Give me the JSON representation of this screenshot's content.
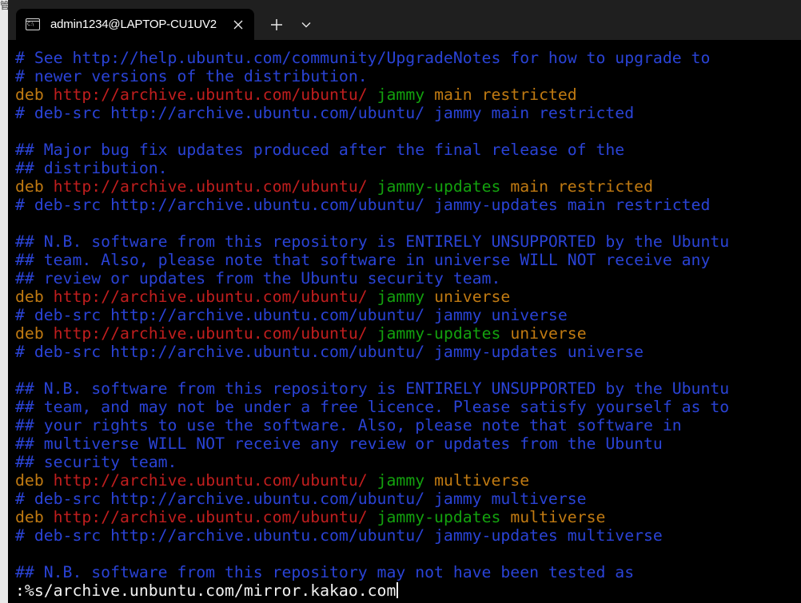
{
  "window": {
    "tab_title": "admin1234@LAPTOP-CU1UV2"
  },
  "background_window": {
    "edge_text": "管"
  },
  "colors": {
    "comment": "#2a43d6",
    "keyword": "#c07a12",
    "url": "#c01e1e",
    "suite": "#13a10e",
    "component": "#c07a12",
    "command": "#f2f2f2",
    "terminal_bg": "#000000",
    "titlebar_bg": "#1f1f1f"
  },
  "icons": {
    "tab_icon": "terminal-icon",
    "close": "close-icon",
    "new_tab": "plus-icon",
    "dropdown": "chevron-down-icon"
  },
  "terminal": {
    "lines": [
      [
        {
          "t": "# See http://help.ubuntu.com/community/UpgradeNotes for how to upgrade to",
          "c": "comment"
        }
      ],
      [
        {
          "t": "# newer versions of the distribution.",
          "c": "comment"
        }
      ],
      [
        {
          "t": "deb",
          "c": "keyword"
        },
        {
          "t": " ",
          "c": "plain"
        },
        {
          "t": "http://archive.ubuntu.com/ubuntu/",
          "c": "url"
        },
        {
          "t": " ",
          "c": "plain"
        },
        {
          "t": "jammy",
          "c": "suite"
        },
        {
          "t": " ",
          "c": "plain"
        },
        {
          "t": "main restricted",
          "c": "comp"
        }
      ],
      [
        {
          "t": "# deb-src http://archive.ubuntu.com/ubuntu/ jammy main restricted",
          "c": "comment"
        }
      ],
      [],
      [
        {
          "t": "## Major bug fix updates produced after the final release of the",
          "c": "comment"
        }
      ],
      [
        {
          "t": "## distribution.",
          "c": "comment"
        }
      ],
      [
        {
          "t": "deb",
          "c": "keyword"
        },
        {
          "t": " ",
          "c": "plain"
        },
        {
          "t": "http://archive.ubuntu.com/ubuntu/",
          "c": "url"
        },
        {
          "t": " ",
          "c": "plain"
        },
        {
          "t": "jammy-updates",
          "c": "suite"
        },
        {
          "t": " ",
          "c": "plain"
        },
        {
          "t": "main restricted",
          "c": "comp"
        }
      ],
      [
        {
          "t": "# deb-src http://archive.ubuntu.com/ubuntu/ jammy-updates main restricted",
          "c": "comment"
        }
      ],
      [],
      [
        {
          "t": "## N.B. software from this repository is ENTIRELY UNSUPPORTED by the Ubuntu",
          "c": "comment"
        }
      ],
      [
        {
          "t": "## team. Also, please note that software in universe WILL NOT receive any",
          "c": "comment"
        }
      ],
      [
        {
          "t": "## review or updates from the Ubuntu security team.",
          "c": "comment"
        }
      ],
      [
        {
          "t": "deb",
          "c": "keyword"
        },
        {
          "t": " ",
          "c": "plain"
        },
        {
          "t": "http://archive.ubuntu.com/ubuntu/",
          "c": "url"
        },
        {
          "t": " ",
          "c": "plain"
        },
        {
          "t": "jammy",
          "c": "suite"
        },
        {
          "t": " ",
          "c": "plain"
        },
        {
          "t": "universe",
          "c": "comp"
        }
      ],
      [
        {
          "t": "# deb-src http://archive.ubuntu.com/ubuntu/ jammy universe",
          "c": "comment"
        }
      ],
      [
        {
          "t": "deb",
          "c": "keyword"
        },
        {
          "t": " ",
          "c": "plain"
        },
        {
          "t": "http://archive.ubuntu.com/ubuntu/",
          "c": "url"
        },
        {
          "t": " ",
          "c": "plain"
        },
        {
          "t": "jammy-updates",
          "c": "suite"
        },
        {
          "t": " ",
          "c": "plain"
        },
        {
          "t": "universe",
          "c": "comp"
        }
      ],
      [
        {
          "t": "# deb-src http://archive.ubuntu.com/ubuntu/ jammy-updates universe",
          "c": "comment"
        }
      ],
      [],
      [
        {
          "t": "## N.B. software from this repository is ENTIRELY UNSUPPORTED by the Ubuntu",
          "c": "comment"
        }
      ],
      [
        {
          "t": "## team, and may not be under a free licence. Please satisfy yourself as to",
          "c": "comment"
        }
      ],
      [
        {
          "t": "## your rights to use the software. Also, please note that software in",
          "c": "comment"
        }
      ],
      [
        {
          "t": "## multiverse WILL NOT receive any review or updates from the Ubuntu",
          "c": "comment"
        }
      ],
      [
        {
          "t": "## security team.",
          "c": "comment"
        }
      ],
      [
        {
          "t": "deb",
          "c": "keyword"
        },
        {
          "t": " ",
          "c": "plain"
        },
        {
          "t": "http://archive.ubuntu.com/ubuntu/",
          "c": "url"
        },
        {
          "t": " ",
          "c": "plain"
        },
        {
          "t": "jammy",
          "c": "suite"
        },
        {
          "t": " ",
          "c": "plain"
        },
        {
          "t": "multiverse",
          "c": "comp"
        }
      ],
      [
        {
          "t": "# deb-src http://archive.ubuntu.com/ubuntu/ jammy multiverse",
          "c": "comment"
        }
      ],
      [
        {
          "t": "deb",
          "c": "keyword"
        },
        {
          "t": " ",
          "c": "plain"
        },
        {
          "t": "http://archive.ubuntu.com/ubuntu/",
          "c": "url"
        },
        {
          "t": " ",
          "c": "plain"
        },
        {
          "t": "jammy-updates",
          "c": "suite"
        },
        {
          "t": " ",
          "c": "plain"
        },
        {
          "t": "multiverse",
          "c": "comp"
        }
      ],
      [
        {
          "t": "# deb-src http://archive.ubuntu.com/ubuntu/ jammy-updates multiverse",
          "c": "comment"
        }
      ],
      [],
      [
        {
          "t": "## N.B. software from this repository may not have been tested as",
          "c": "comment"
        }
      ]
    ],
    "command_line": ":%s/archive.unbuntu.com/mirror.kakao.com"
  }
}
